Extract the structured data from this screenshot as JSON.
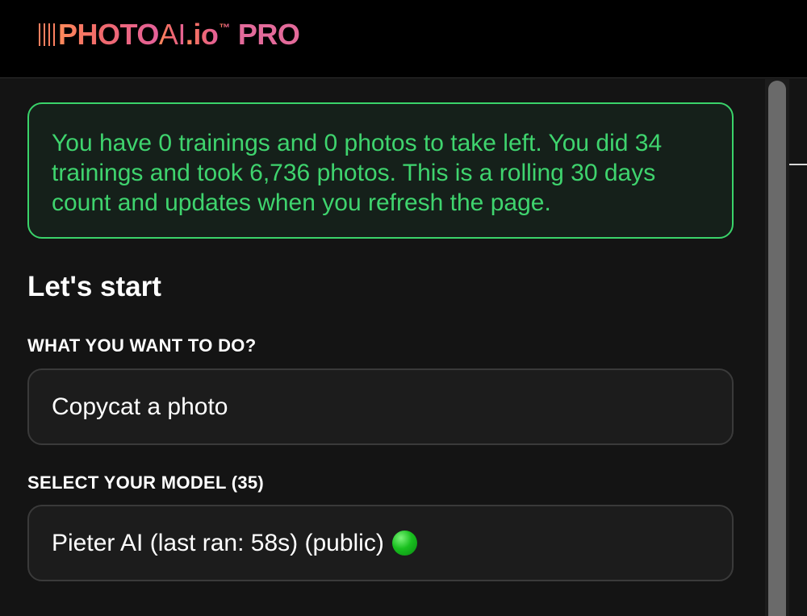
{
  "header": {
    "logo": {
      "photo": "PHOTO",
      "ai": "AI",
      "domain": ".io",
      "tm": "™",
      "pro": "PRO"
    }
  },
  "notice": {
    "text": "You have 0 trainings and 0 photos to take left. You did 34 trainings and took 6,736 photos. This is a rolling 30 days count and updates when you refresh the page."
  },
  "main": {
    "heading": "Let's start",
    "task": {
      "label": "WHAT YOU WANT TO DO?",
      "value": "Copycat a photo"
    },
    "model": {
      "label": "SELECT YOUR MODEL (35)",
      "value": "Pieter AI (last ran: 58s) (public)",
      "status_icon": "green-circle-icon"
    }
  },
  "colors": {
    "notice_green": "#3fd46e",
    "logo_orange": "#ff8a5a",
    "logo_pink": "#e36a9a",
    "background": "#141414"
  }
}
